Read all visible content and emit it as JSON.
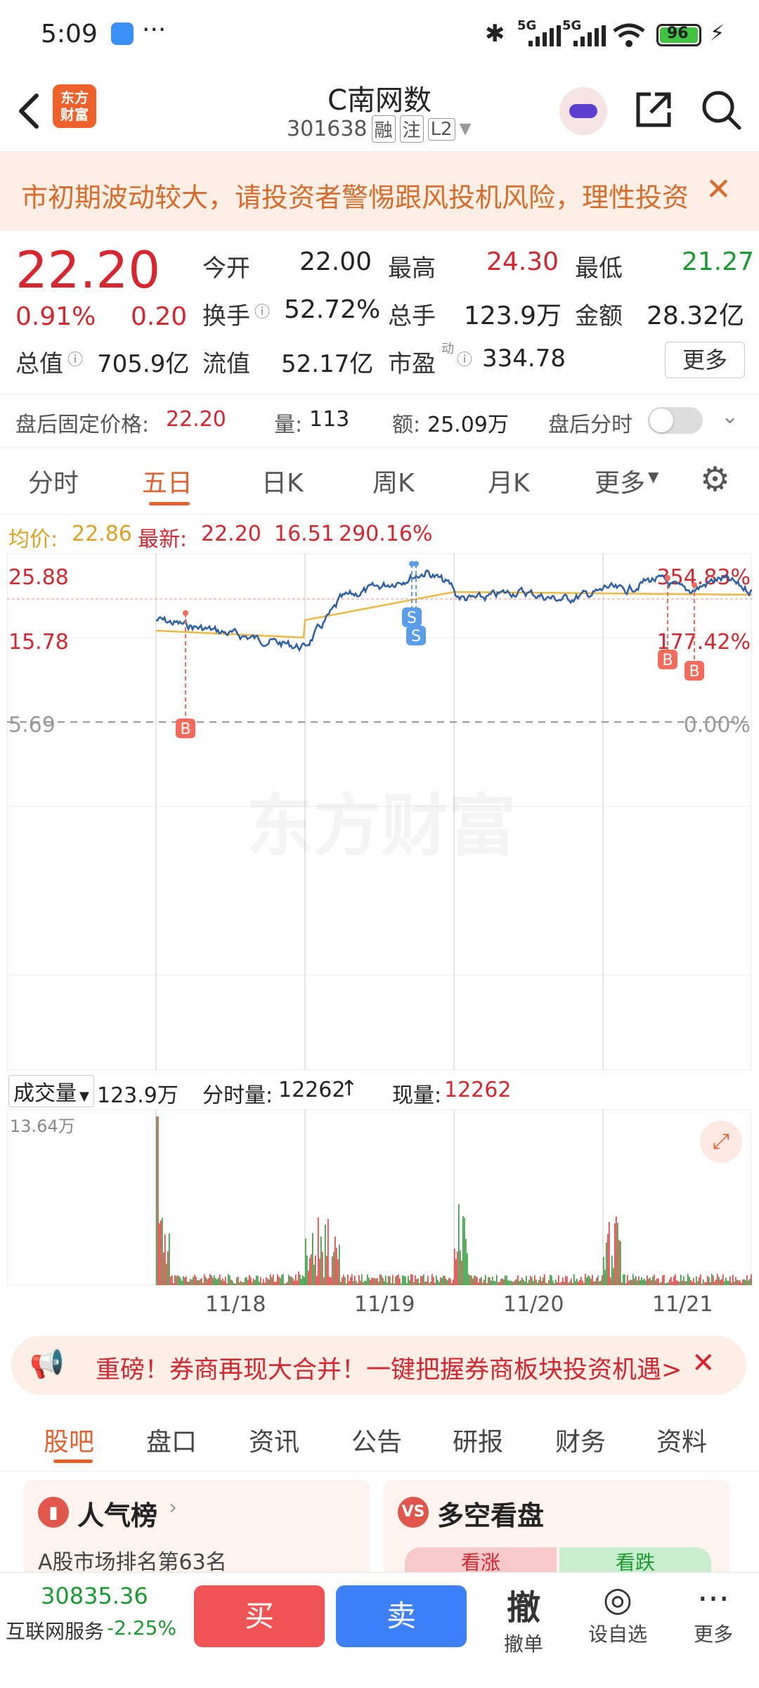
{
  "status_bar": {
    "time": "5:09",
    "dots": "···",
    "battery": "96",
    "net1": "5G",
    "net2": "5G"
  },
  "nav": {
    "back_icon": "chevron-left-icon",
    "logo_line1": "东方",
    "logo_line2": "财富",
    "title": "C南网数",
    "code": "301638",
    "tag1": "融",
    "tag2": "注",
    "tag3": "L2"
  },
  "warning": {
    "text": "市初期波动较大，请投资者警惕跟风投机风险，理性投资"
  },
  "quote": {
    "price": "22.20",
    "change_pct": "0.91%",
    "change_abs": "0.20",
    "open_label": "今开",
    "open": "22.00",
    "high_label": "最高",
    "high": "24.30",
    "low_label": "最低",
    "low": "21.27",
    "turnover_label": "换手",
    "turnover": "52.72%",
    "volume_label": "总手",
    "volume": "123.9万",
    "amount_label": "金额",
    "amount": "28.32亿",
    "mktcap_label": "总值",
    "mktcap": "705.9亿",
    "float_label": "流值",
    "float": "52.17亿",
    "pe_label": "市盈",
    "pe_sup": "动",
    "pe": "334.78",
    "more": "更多"
  },
  "after_hours": {
    "price_label": "盘后固定价格:",
    "price": "22.20",
    "vol_label": "量:",
    "vol": "113",
    "amt_label": "额:",
    "amt": "25.09万",
    "toggle_label": "盘后分时"
  },
  "chart_tabs": [
    "分时",
    "五日",
    "日K",
    "周K",
    "月K",
    "更多"
  ],
  "chart_info": {
    "avg_label": "均价:",
    "avg": "22.86",
    "last_label": "最新:",
    "last": "22.20",
    "chg": "16.51",
    "chg_pct": "290.16%"
  },
  "chart_data": {
    "type": "line",
    "y_left_ticks": [
      "25.88",
      "15.78",
      "5.69"
    ],
    "y_right_ticks": [
      "354.83%",
      "177.42%",
      "0.00%"
    ],
    "x": [
      "11/18",
      "11/19",
      "11/20",
      "11/21"
    ],
    "series": [],
    "markers": [
      "B",
      "S",
      "S",
      "B",
      "B"
    ],
    "ylim": [
      5.69,
      25.88
    ]
  },
  "watermark": "东方财富",
  "vol_info": {
    "selector": "成交量",
    "total": "123.9万",
    "tick_label": "分时量:",
    "tick": "12262",
    "now_label": "现量:",
    "now": "12262",
    "max": "13.64万"
  },
  "ad": {
    "text": "重磅！券商再现大合并！一键把握券商板块投资机遇>"
  },
  "sub_tabs": [
    "股吧",
    "盘口",
    "资讯",
    "公告",
    "研报",
    "财务",
    "资料"
  ],
  "cards": {
    "left_title": "人气榜",
    "left_sub": "A股市场排名第63名",
    "right_title": "多空看盘",
    "right_up": "看涨",
    "right_down": "看跌"
  },
  "bottom": {
    "index_value": "30835.36",
    "index_name": "互联网服务",
    "index_chg": "-2.25%",
    "buy": "买",
    "sell": "卖",
    "cancel_big": "撤",
    "cancel": "撤单",
    "watch": "设自选",
    "more": "更多"
  }
}
